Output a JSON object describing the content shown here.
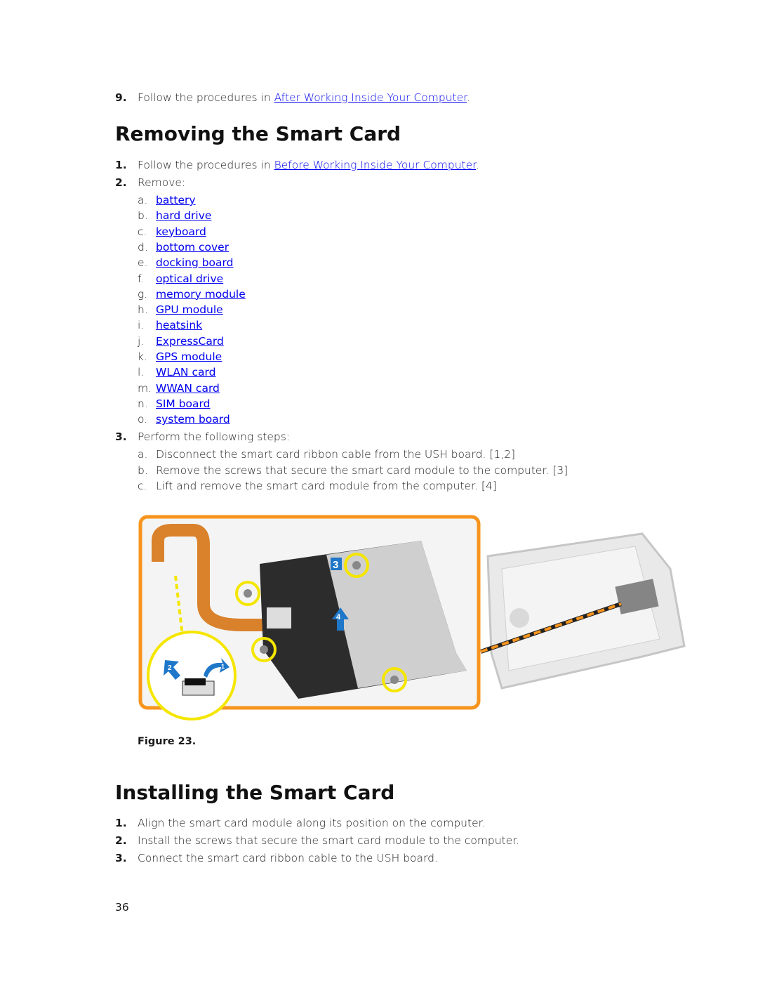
{
  "prev_step": {
    "number": "9.",
    "text": "Follow the procedures in ",
    "link": "After Working Inside Your Computer",
    "suffix": "."
  },
  "removing": {
    "title": "Removing the Smart Card",
    "steps": [
      {
        "number": "1.",
        "text": "Follow the procedures in ",
        "link": "Before Working Inside Your Computer",
        "suffix": "."
      },
      {
        "number": "2.",
        "text": "Remove:"
      },
      {
        "number": "3.",
        "text": "Perform the following steps:"
      }
    ],
    "remove_items": [
      {
        "letter": "a.",
        "link": "battery"
      },
      {
        "letter": "b.",
        "link": "hard drive"
      },
      {
        "letter": "c.",
        "link": "keyboard"
      },
      {
        "letter": "d.",
        "link": "bottom cover"
      },
      {
        "letter": "e.",
        "link": "docking board"
      },
      {
        "letter": "f.",
        "link": "optical drive"
      },
      {
        "letter": "g.",
        "link": "memory module"
      },
      {
        "letter": "h.",
        "link": "GPU module"
      },
      {
        "letter": "i.",
        "link": "heatsink"
      },
      {
        "letter": "j.",
        "link": "ExpressCard"
      },
      {
        "letter": "k.",
        "link": "GPS module"
      },
      {
        "letter": "l.",
        "link": "WLAN card"
      },
      {
        "letter": "m.",
        "link": "WWAN card"
      },
      {
        "letter": "n.",
        "link": "SIM board"
      },
      {
        "letter": "o.",
        "link": "system board"
      }
    ],
    "perform_items": [
      {
        "letter": "a.",
        "text": "Disconnect the smart card ribbon cable from the USH board. [1,2]"
      },
      {
        "letter": "b.",
        "text": "Remove the screws that secure the smart card module to the computer. [3]"
      },
      {
        "letter": "c.",
        "text": "Lift and remove the smart card module from the computer. [4]"
      }
    ],
    "figure": {
      "caption": "Figure 23.",
      "callouts": [
        "1",
        "2",
        "3",
        "4"
      ],
      "accent": "#f7941d",
      "highlight": "#f5e600",
      "callout_color": "#1f77c9"
    }
  },
  "installing": {
    "title": "Installing the Smart Card",
    "steps": [
      {
        "number": "1.",
        "text": "Align the smart card module along its position on the computer."
      },
      {
        "number": "2.",
        "text": "Install the screws that secure the smart card module to the computer."
      },
      {
        "number": "3.",
        "text": "Connect the smart card ribbon cable to the USH board."
      }
    ]
  },
  "page_number": "36"
}
